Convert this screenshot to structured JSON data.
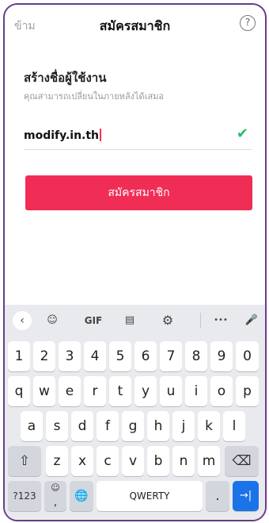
{
  "header": {
    "skip": "ข้าม",
    "title": "สมัครสมาชิก",
    "help": "?"
  },
  "form": {
    "heading": "สร้างชื่อผู้ใช้งาน",
    "subtitle": "คุณสามารถเปลี่ยนในภายหลังได้เสมอ",
    "username": "modify.in.th",
    "check": "✔",
    "submit": "สมัครสมาชิก"
  },
  "keyboard": {
    "toolbar": {
      "back": "‹",
      "sticker": "☺",
      "gif": "GIF",
      "clipboard": "▤",
      "settings": "⚙",
      "more": "•••",
      "mic": "🎤"
    },
    "row_numbers": [
      "1",
      "2",
      "3",
      "4",
      "5",
      "6",
      "7",
      "8",
      "9",
      "0"
    ],
    "row_top": [
      "q",
      "w",
      "e",
      "r",
      "t",
      "y",
      "u",
      "i",
      "o",
      "p"
    ],
    "row_mid": [
      "a",
      "s",
      "d",
      "f",
      "g",
      "h",
      "j",
      "k",
      "l"
    ],
    "row_bot": [
      "z",
      "x",
      "c",
      "v",
      "b",
      "n",
      "m"
    ],
    "shift": "⇧",
    "backspace": "⌫",
    "symbols": "?123",
    "emoji": "☺",
    "comma": ",",
    "globe": "🌐",
    "space": "QWERTY",
    "period": ".",
    "enter": "→|"
  }
}
